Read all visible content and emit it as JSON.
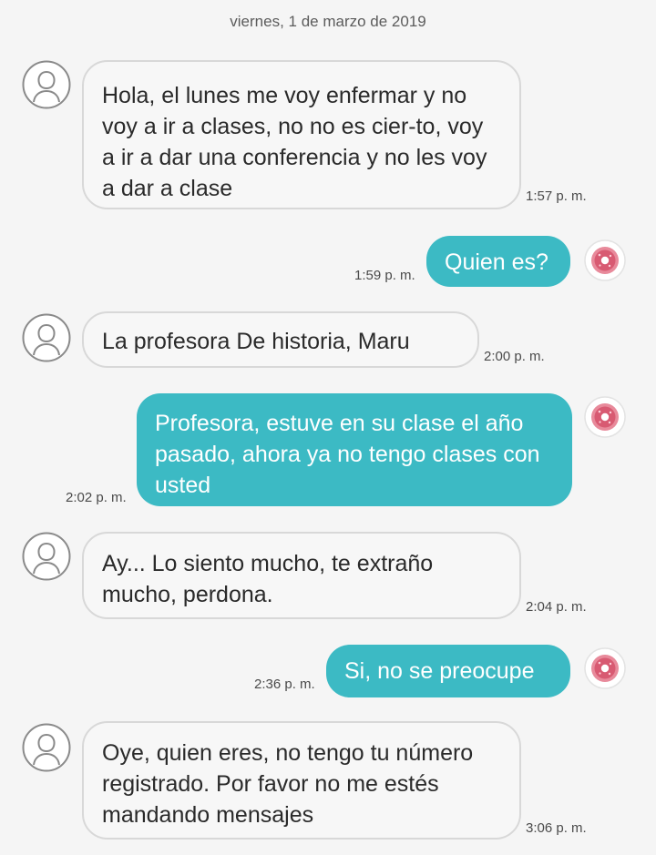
{
  "conversation": {
    "date_header": "viernes, 1 de marzo de 2019",
    "messages": [
      {
        "direction": "incoming",
        "text": "Hola, el lunes me voy enfermar y no voy a ir a clases, no no es cier-to, voy a ir a dar una conferencia y no les voy a dar a clase",
        "time": "1:57 p. m."
      },
      {
        "direction": "outgoing",
        "text": "Quien es?",
        "time": "1:59 p. m."
      },
      {
        "direction": "incoming",
        "text": "La profesora De historia, Maru",
        "time": "2:00 p. m."
      },
      {
        "direction": "outgoing",
        "text": "Profesora, estuve en su clase el año pasado, ahora ya no tengo clases con usted",
        "time": "2:02 p. m."
      },
      {
        "direction": "incoming",
        "text": "Ay... Lo siento mucho, te extraño mucho, perdona.",
        "time": "2:04 p. m."
      },
      {
        "direction": "outgoing",
        "text": "Si, no se preocupe",
        "time": "2:36 p. m."
      },
      {
        "direction": "incoming",
        "text": "Oye, quien eres, no tengo tu número registrado. Por favor no me estés mandando mensajes",
        "time": "3:06 p. m."
      }
    ]
  },
  "icons": {
    "contact_avatar": "person-outline-icon",
    "own_avatar": "pink-donut-sticker-icon"
  },
  "colors": {
    "outgoing_bubble": "#3cbac4",
    "incoming_bubble": "#f7f7f7",
    "incoming_border": "#d8d8d8",
    "background": "#f5f5f5"
  }
}
